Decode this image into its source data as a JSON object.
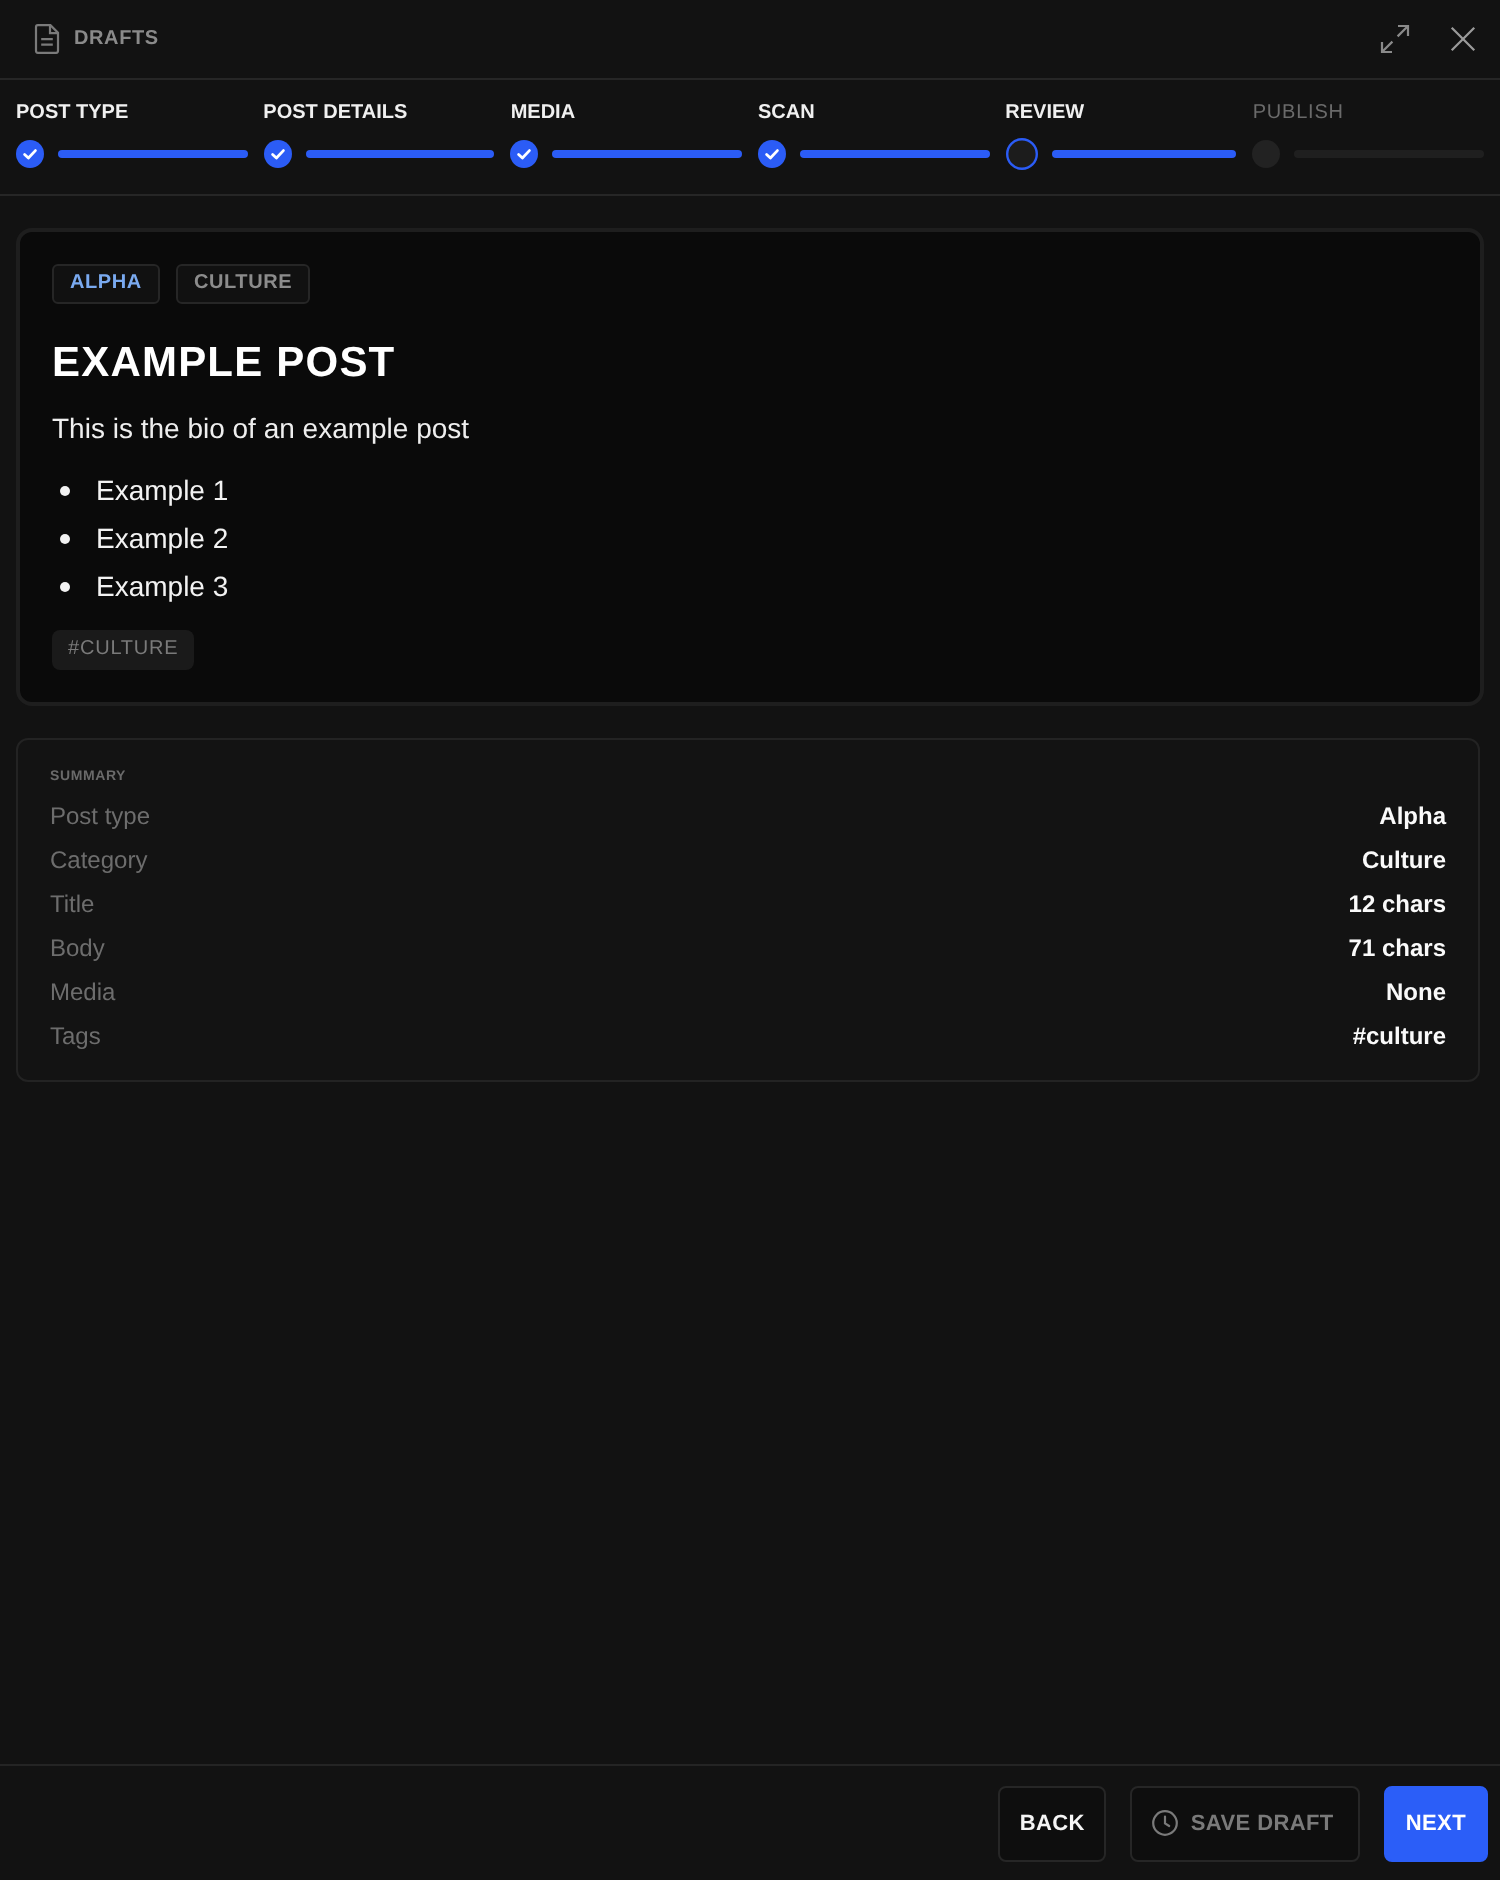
{
  "header": {
    "title": "DRAFTS"
  },
  "steps": [
    {
      "label": "POST TYPE",
      "completed": true,
      "selected": false
    },
    {
      "label": "POST DETAILS",
      "completed": true,
      "selected": false
    },
    {
      "label": "MEDIA",
      "completed": true,
      "selected": false
    },
    {
      "label": "SCAN",
      "completed": true,
      "selected": false
    },
    {
      "label": "REVIEW",
      "completed": false,
      "selected": true
    },
    {
      "label": "PUBLISH",
      "completed": false,
      "selected": false
    }
  ],
  "preview": {
    "tags": [
      {
        "label": "ALPHA",
        "color": "#7aaaf0"
      },
      {
        "label": "CULTURE",
        "color": "#8c8c8c"
      }
    ],
    "title": "EXAMPLE POST",
    "bio": "This is the bio of an example post",
    "bullets": [
      "Example 1",
      "Example 2",
      "Example 3"
    ],
    "hashtags": [
      "#CULTURE"
    ]
  },
  "summary": {
    "heading": "SUMMARY",
    "rows": [
      {
        "label": "Post type",
        "value": "Alpha"
      },
      {
        "label": "Category",
        "value": "Culture"
      },
      {
        "label": "Title",
        "value": "12 chars"
      },
      {
        "label": "Body",
        "value": "71 chars"
      },
      {
        "label": "Media",
        "value": "None"
      },
      {
        "label": "Tags",
        "value": "#culture"
      }
    ]
  },
  "buttons": [
    {
      "label": "BACK",
      "kind": "outline",
      "disabled": false
    },
    {
      "label": "SAVE DRAFT",
      "kind": "draft",
      "disabled": true
    },
    {
      "label": "NEXT",
      "kind": "primary",
      "disabled": false
    }
  ]
}
